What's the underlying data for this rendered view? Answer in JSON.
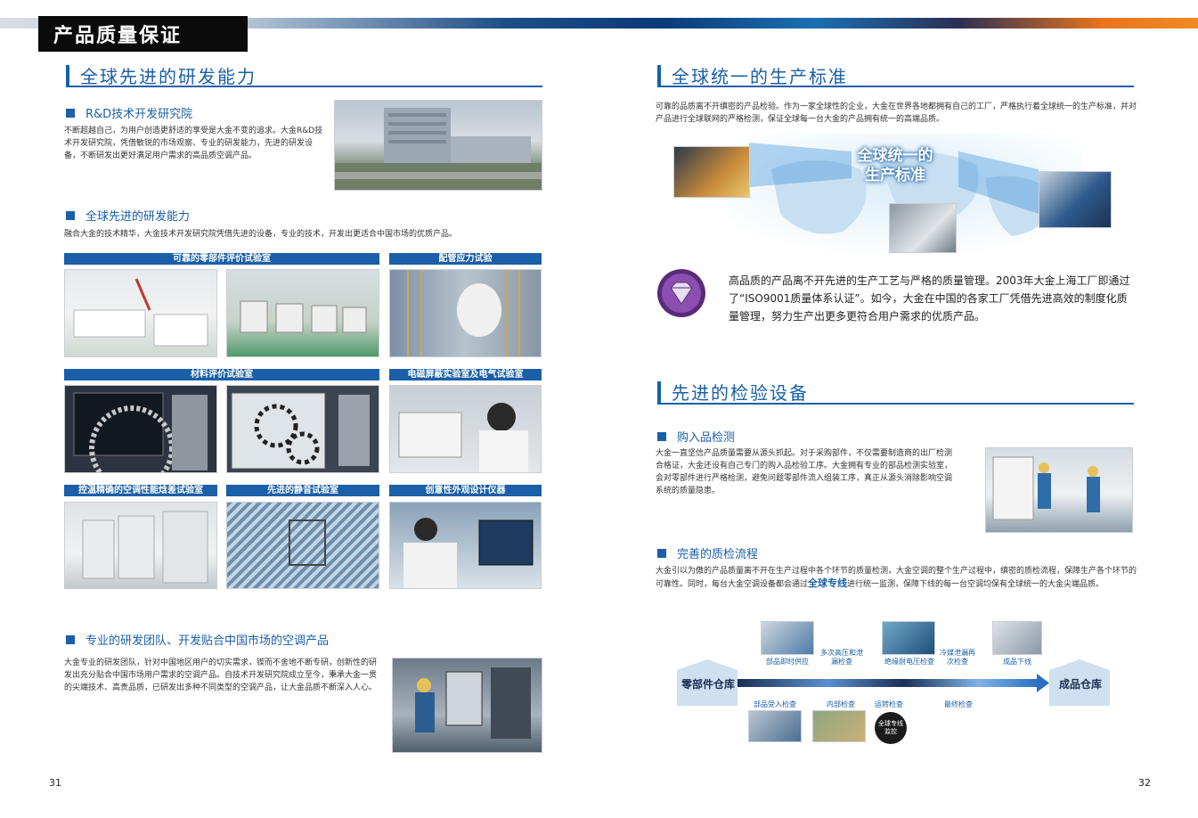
{
  "header": {
    "title": "产品质量保证"
  },
  "left": {
    "section_title": "全球先进的研发能力",
    "rd": {
      "title": "R&D技术开发研究院",
      "text": "不断超越自己，为用户创造更舒适的享受是大金不变的追求。大金R&D技术开发研究院，凭借敏锐的市场观察、专业的研发能力，先进的研发设备，不断研发出更好满足用户需求的高品质空调产品。"
    },
    "adv": {
      "title": "全球先进的研发能力",
      "text": "融合大金的技术精华，大金技术开发研究院凭借先进的设备，专业的技术，开发出更适合中国市场的优质产品。"
    },
    "labs": [
      "可靠的零部件评价试验室",
      "配管应力试验",
      "材料评价试验室",
      "电磁屏蔽实验室及电气试验室",
      "控温精确的空调性能焓差试验室",
      "先进的静音试验室",
      "创意性外观设计仪器"
    ],
    "team": {
      "title": "专业的研发团队、开发贴合中国市场的空调产品",
      "text": "大金专业的研发团队，针对中国地区用户的切实需求，锲而不舍地不断专研，创新性的研发出充分贴合中国市场用户需求的空调产品。自技术开发研究院成立至今，秉承大金一贯的尖端技术、高贵品质，已研发出多种不同类型的空调产品，让大金品质不断深入人心。"
    },
    "page_number": "31"
  },
  "right": {
    "section1_title": "全球统一的生产标准",
    "section1_text": "可靠的品质离不开缜密的产品检验。作为一家全球性的企业，大金在世界各地都拥有自己的工厂，严格执行着全球统一的生产标准，并对产品进行全球联网的严格检测，保证全球每一台大金的产品拥有统一的高端品质。",
    "map_label_1": "全球统一的",
    "map_label_2": "生产标准",
    "quality_text": "高品质的产品离不开先进的生产工艺与严格的质量管理。2003年大金上海工厂即通过了“ISO9001质量体系认证”。如今，大金在中国的各家工厂凭借先进高效的制度化质量管理，努力生产出更多更符合用户需求的优质产品。",
    "section2_title": "先进的检验设备",
    "incoming": {
      "title": "购入品检测",
      "text": "大金一直坚信产品质量需要从源头抓起。对于采购部件，不仅需要制造商的出厂检测合格证，大金还设有自己专门的购入品检验工序。大金拥有专业的部品检测实验室，会对零部件进行严格检测，避免问题零部件流入组装工序，真正从源头消除影响空调系统的质量隐患。"
    },
    "process": {
      "title": "完善的质检流程",
      "text_before": "大金引以为傲的产品质量离不开在生产过程中各个环节的质量检测，大金空调的整个生产过程中，缜密的质检流程，保障生产各个环节的可靠性。同时，每台大金空调设备都会通过",
      "text_highlight": "全球专线",
      "text_after": "进行统一监测，保障下线的每一台空调均保有全球统一的大金尖端品质。"
    },
    "flow": {
      "start": "零部件仓库",
      "end": "成品仓库",
      "top_labels": [
        "部品即时供应",
        "多次高压和泄漏检查",
        "绝缘耐电压检查",
        "冷媒泄漏再次检查",
        "成品下线"
      ],
      "bottom_labels": [
        "部品受入检查",
        "内部检查",
        "运转检查",
        "最终检查"
      ],
      "badge": "全球专线监控"
    },
    "page_number": "32"
  }
}
